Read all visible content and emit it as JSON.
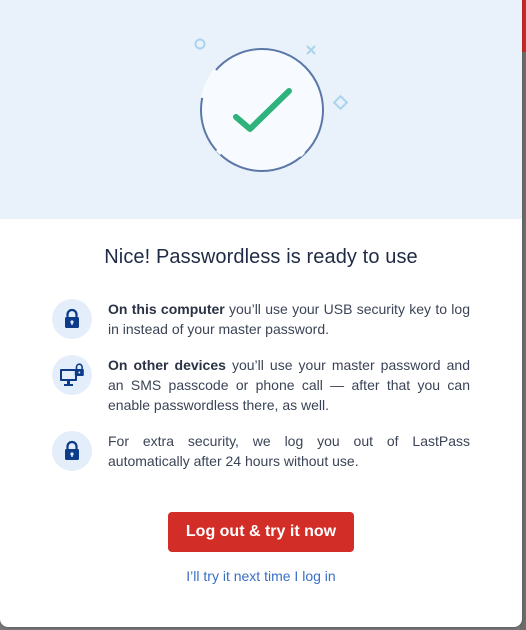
{
  "dialog": {
    "title": "Nice! Passwordless is ready to use",
    "items": [
      {
        "icon": "lock-icon",
        "bold": "On this computer",
        "text": " you’ll use your USB security key to log in instead of your master password."
      },
      {
        "icon": "computer-lock-icon",
        "bold": "On other devices",
        "text": " you’ll use your master password and an SMS passcode or phone call — after that you can enable passwordless there, as well."
      },
      {
        "icon": "lock-icon",
        "bold": "",
        "text": "For extra security, we log you out of LastPass automatically after 24 hours without use."
      }
    ],
    "primary_button": "Log out & try it now",
    "secondary_link": "I’ll try it next time I log in"
  },
  "colors": {
    "hero_background": "#e9f2fb",
    "check": "#2fb37d",
    "primary": "#d32d27",
    "link": "#3a6fc4",
    "icon": "#0d3b8a"
  }
}
